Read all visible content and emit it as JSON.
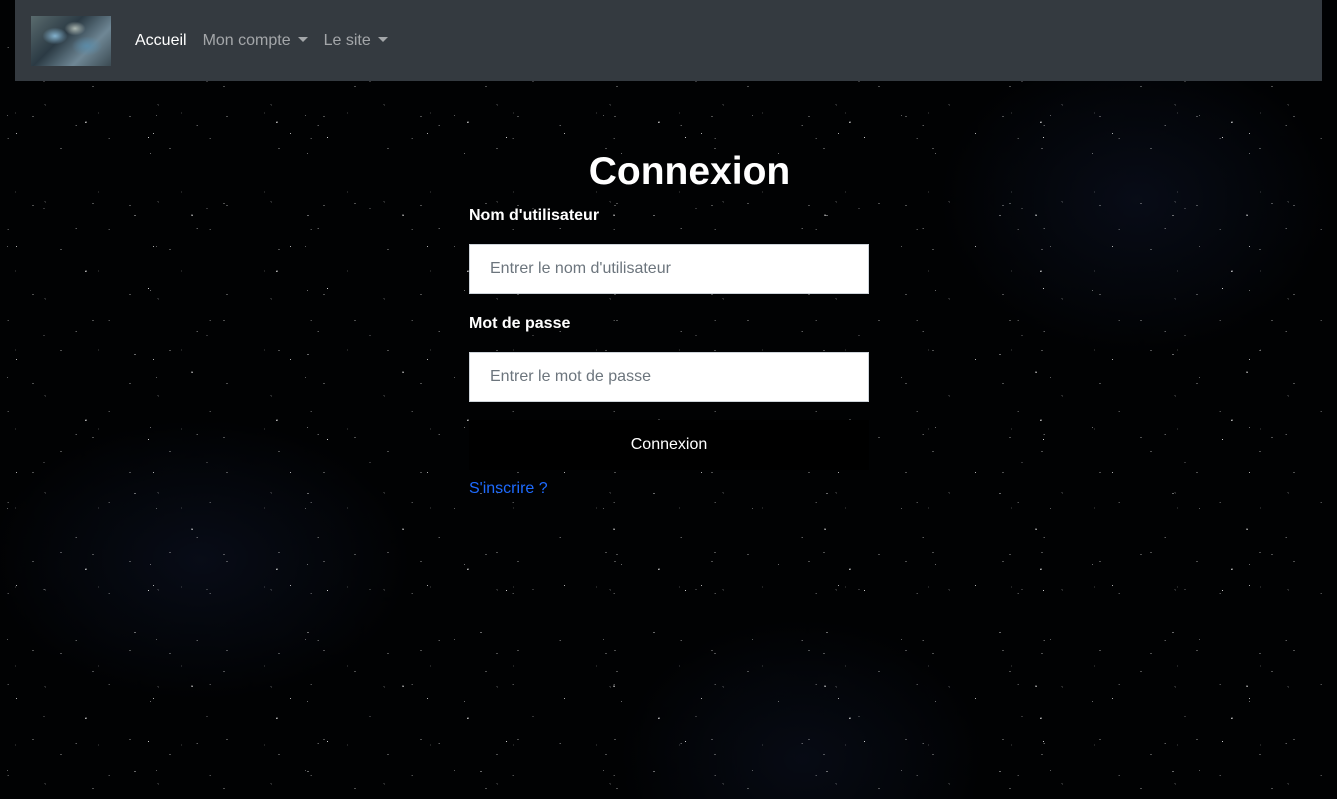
{
  "navbar": {
    "logo_alt": "logo",
    "items": [
      {
        "label": "Accueil",
        "active": true,
        "dropdown": false
      },
      {
        "label": "Mon compte",
        "active": false,
        "dropdown": true
      },
      {
        "label": "Le site",
        "active": false,
        "dropdown": true
      }
    ]
  },
  "login": {
    "title": "Connexion",
    "username_label": "Nom d'utilisateur",
    "username_placeholder": "Entrer le nom d'utilisateur",
    "username_value": "",
    "password_label": "Mot de passe",
    "password_placeholder": "Entrer le mot de passe",
    "password_value": "",
    "submit_label": "Connexion",
    "register_link": "S'inscrire ?"
  },
  "colors": {
    "navbar_bg": "#343a40",
    "link": "#1e6bff",
    "button_bg": "#000000"
  }
}
